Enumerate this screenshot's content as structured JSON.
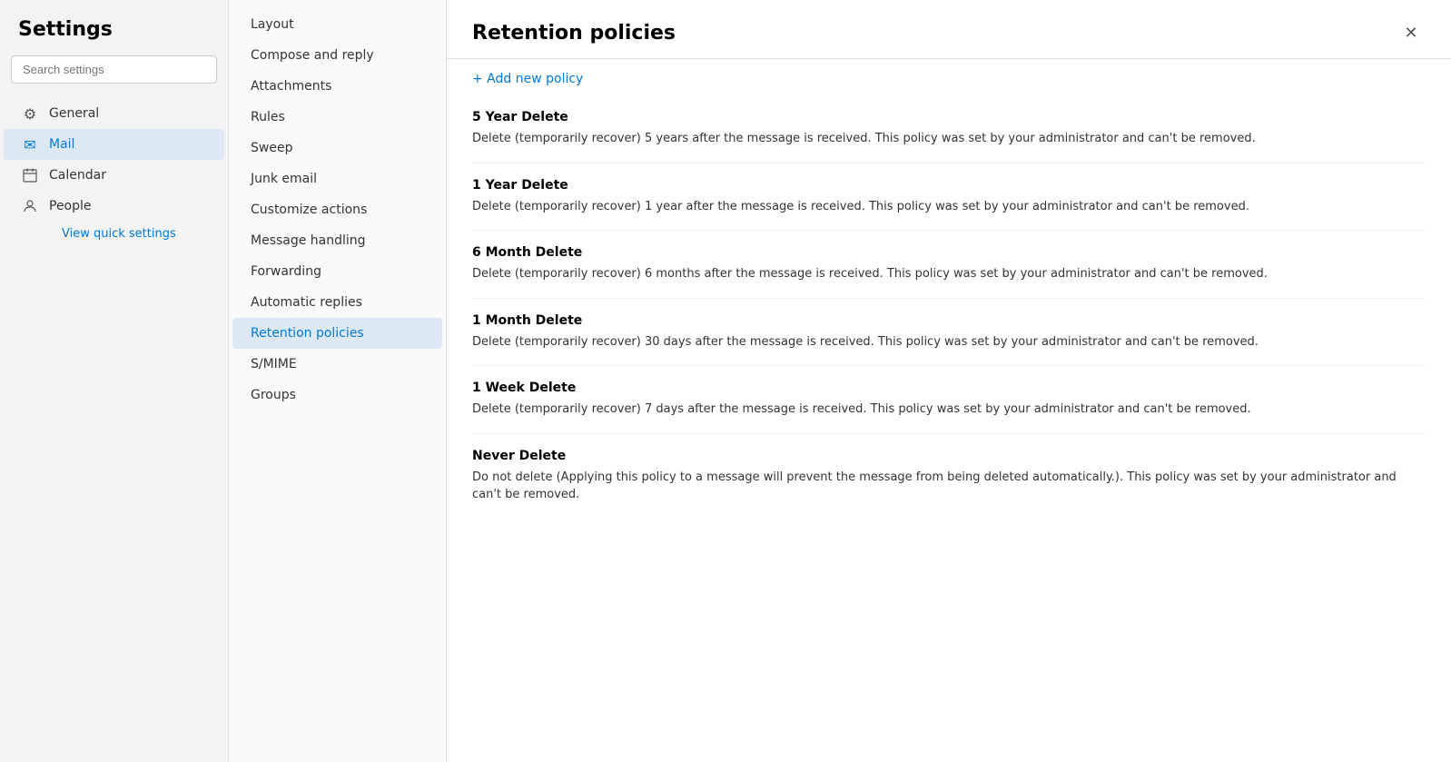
{
  "app": {
    "title": "Settings"
  },
  "search": {
    "placeholder": "Search settings",
    "value": ""
  },
  "sidebar": {
    "items": [
      {
        "id": "general",
        "label": "General",
        "icon": "⚙",
        "active": false
      },
      {
        "id": "mail",
        "label": "Mail",
        "icon": "✉",
        "active": true
      },
      {
        "id": "calendar",
        "label": "Calendar",
        "icon": "📅",
        "active": false
      },
      {
        "id": "people",
        "label": "People",
        "icon": "👤",
        "active": false
      }
    ],
    "view_quick_settings": "View quick settings"
  },
  "submenu": {
    "items": [
      {
        "id": "layout",
        "label": "Layout",
        "active": false
      },
      {
        "id": "compose-reply",
        "label": "Compose and reply",
        "active": false
      },
      {
        "id": "attachments",
        "label": "Attachments",
        "active": false
      },
      {
        "id": "rules",
        "label": "Rules",
        "active": false
      },
      {
        "id": "sweep",
        "label": "Sweep",
        "active": false
      },
      {
        "id": "junk-email",
        "label": "Junk email",
        "active": false
      },
      {
        "id": "customize-actions",
        "label": "Customize actions",
        "active": false
      },
      {
        "id": "message-handling",
        "label": "Message handling",
        "active": false
      },
      {
        "id": "forwarding",
        "label": "Forwarding",
        "active": false
      },
      {
        "id": "automatic-replies",
        "label": "Automatic replies",
        "active": false
      },
      {
        "id": "retention-policies",
        "label": "Retention policies",
        "active": true
      },
      {
        "id": "smime",
        "label": "S/MIME",
        "active": false
      },
      {
        "id": "groups",
        "label": "Groups",
        "active": false
      }
    ]
  },
  "panel": {
    "title": "Retention policies",
    "add_policy_label": "+ Add new policy",
    "policies": [
      {
        "id": "5year",
        "name": "5 Year Delete",
        "description": "Delete (temporarily recover) 5 years after the message is received. This policy was set by your administrator and can't be removed."
      },
      {
        "id": "1year",
        "name": "1 Year Delete",
        "description": "Delete (temporarily recover) 1 year after the message is received. This policy was set by your administrator and can't be removed."
      },
      {
        "id": "6month",
        "name": "6 Month Delete",
        "description": "Delete (temporarily recover) 6 months after the message is received. This policy was set by your administrator and can't be removed."
      },
      {
        "id": "1month",
        "name": "1 Month Delete",
        "description": "Delete (temporarily recover) 30 days after the message is received. This policy was set by your administrator and can't be removed."
      },
      {
        "id": "1week",
        "name": "1 Week Delete",
        "description": "Delete (temporarily recover) 7 days after the message is received. This policy was set by your administrator and can't be removed."
      },
      {
        "id": "never",
        "name": "Never Delete",
        "description": "Do not delete (Applying this policy to a message will prevent the message from being deleted automatically.). This policy was set by your administrator and can't be removed."
      }
    ]
  }
}
